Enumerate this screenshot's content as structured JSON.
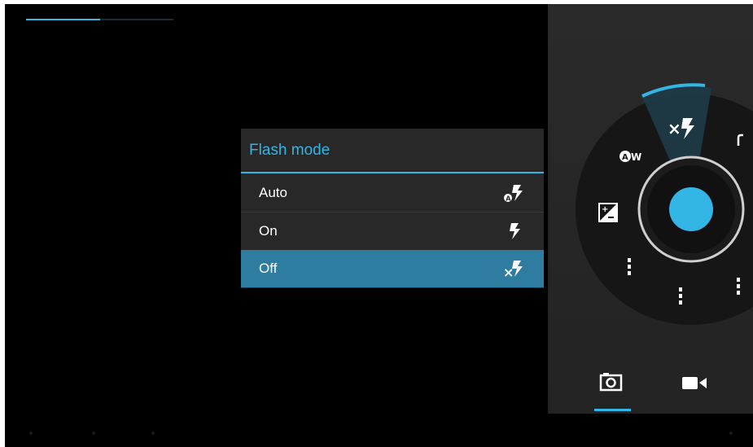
{
  "progress": {
    "fraction": 0.5
  },
  "dialog": {
    "title": "Flash mode",
    "options": [
      {
        "label": "Auto",
        "icon": "flash-auto-icon",
        "selected": false
      },
      {
        "label": "On",
        "icon": "flash-on-icon",
        "selected": false
      },
      {
        "label": "Off",
        "icon": "flash-off-icon",
        "selected": true
      }
    ]
  },
  "pie": {
    "items": [
      {
        "icon": "flash-off-icon",
        "active": true
      },
      {
        "icon": "white-balance-auto-icon"
      },
      {
        "icon": "exposure-icon"
      },
      {
        "icon": "more-settings-icon"
      },
      {
        "icon": "more-settings-icon"
      },
      {
        "icon": "more-settings-icon"
      },
      {
        "icon": "partial-icon"
      }
    ],
    "shutter_icon": "shutter-button"
  },
  "mode_bar": {
    "modes": [
      {
        "icon": "camera-icon",
        "selected": true
      },
      {
        "icon": "video-camera-icon",
        "selected": false
      }
    ]
  },
  "colors": {
    "accent": "#33b5e5",
    "selected_row": "#2e7c9f",
    "dialog_bg": "#282828",
    "panel_bg": "#2a2a2a"
  }
}
